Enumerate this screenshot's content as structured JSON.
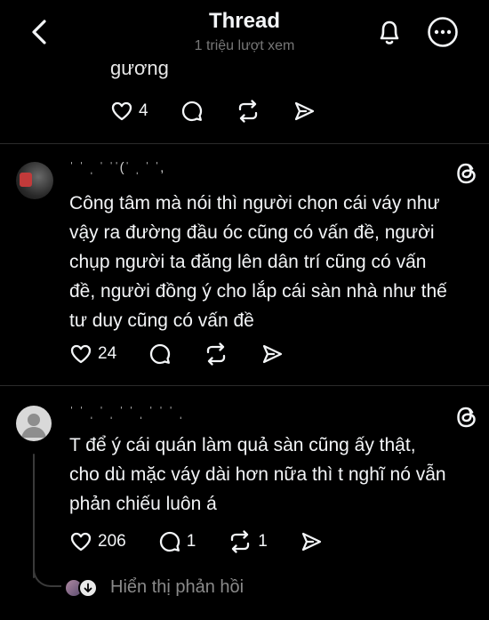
{
  "header": {
    "title": "Thread",
    "views": "1 triệu lượt xem"
  },
  "partial_comment": {
    "cut_text": "gương",
    "actions": {
      "likes": "4",
      "comments": "",
      "reposts": ""
    }
  },
  "comment1": {
    "username": "ˈ ˈ ˌ ˈ ˈˈ(ˈ ˌ ˈ ˈ,",
    "text_lines": [
      "Công tâm mà nói thì người chọn cái váy như",
      "vậy ra đường đầu óc cũng có vấn đề, người",
      "chụp người ta đăng lên dân trí cũng có vấn",
      "đề, người đồng ý cho lắp cái sàn nhà như thế",
      "tư duy cũng có vấn đề"
    ],
    "actions": {
      "likes": "24",
      "comments": "",
      "reposts": ""
    }
  },
  "comment2": {
    "username": "ˈ ˈ ˌ ˈ ˌ ˈ ˈ ˌ ˈ ˈ ˈ ˌ",
    "text_lines": [
      "T để ý cái quán làm quả sàn cũng ấy thật,",
      "cho dù mặc váy dài hơn nữa thì t nghĩ nó vẫn",
      "phản chiếu luôn á"
    ],
    "actions": {
      "likes": "206",
      "comments": "1",
      "reposts": "1"
    }
  },
  "show_replies": "Hiển thị phản hồi",
  "colors": {
    "background": "#000000",
    "text": "#f3f5f7",
    "muted": "#777777",
    "divider": "#2b2b2b"
  }
}
